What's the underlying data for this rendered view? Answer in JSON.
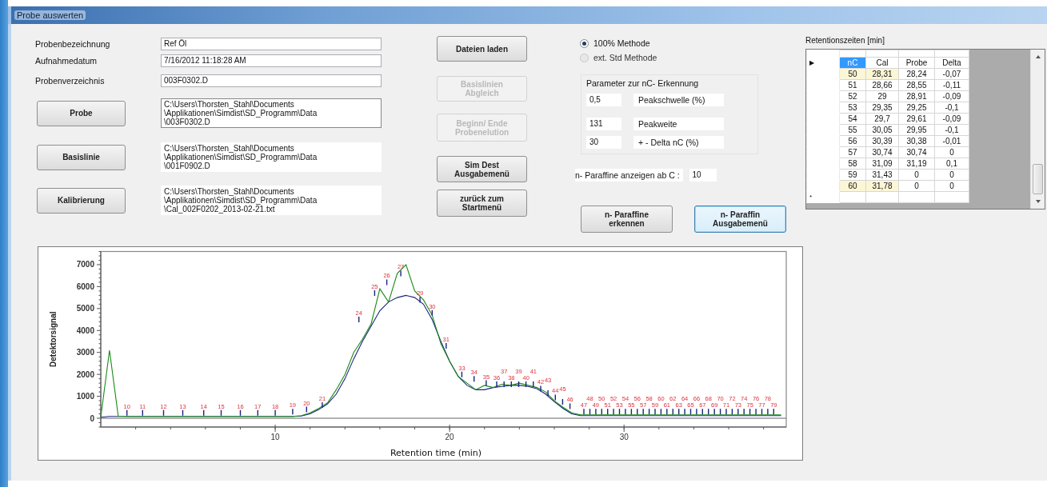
{
  "window": {
    "title": "Probe auswerten"
  },
  "sample": {
    "fields": [
      {
        "label": "Probenbezeichnung",
        "value": "Ref Öl"
      },
      {
        "label": "Aufnahmedatum",
        "value": "7/16/2012 11:18:28 AM"
      },
      {
        "label": "Probenverzeichnis",
        "value": "003F0302.D"
      }
    ],
    "file_rows": [
      {
        "button": "Probe",
        "path_lines": [
          "C:\\Users\\Thorsten_Stahl\\Documents",
          "\\Applikationen\\Simdist\\SD_Programm\\Data",
          "\\003F0302.D"
        ]
      },
      {
        "button": "Basislinie",
        "path_lines": [
          "C:\\Users\\Thorsten_Stahl\\Documents",
          "\\Applikationen\\Simdist\\SD_Programm\\Data",
          "\\001F0902.D"
        ]
      },
      {
        "button": "Kalibrierung",
        "path_lines": [
          "C:\\Users\\Thorsten_Stahl\\Documents",
          "\\Applikationen\\Simdist\\SD_Programm\\Data",
          "\\Cal_002F0202_2013-02-21.txt"
        ]
      }
    ]
  },
  "actions": [
    {
      "label": "Dateien laden",
      "disabled": false
    },
    {
      "label": "Basislinien Abgleich",
      "disabled": true
    },
    {
      "label": "Beginn/ Ende Probenelution",
      "disabled": true
    },
    {
      "label": "Sim Dest Ausgabemenü",
      "disabled": false
    },
    {
      "label": "zurück zum Startmenü",
      "disabled": false
    }
  ],
  "methods": [
    {
      "label": "100% Methode",
      "selected": true,
      "disabled": false
    },
    {
      "label": "ext. Std Methode",
      "selected": false,
      "disabled": true
    }
  ],
  "parameters": {
    "title": "Parameter zur nC- Erkennung",
    "rows": [
      {
        "value": "0,5",
        "label": "Peakschwelle (%)"
      },
      {
        "value": "131",
        "label": "Peakweite"
      },
      {
        "value": "30",
        "label": "+ - Delta nC (%)"
      }
    ]
  },
  "display_from": {
    "label": "n- Paraffine anzeigen ab C :",
    "value": "10"
  },
  "paraffin_buttons": [
    {
      "label": "n- Paraffine erkennen",
      "focused": false
    },
    {
      "label": "n- Paraffin Ausgabemenü",
      "focused": true
    }
  ],
  "table": {
    "title": "Retentionszeiten [min]",
    "current_row_marker": "▶",
    "new_row_marker": "*",
    "columns": [
      {
        "label": "nC",
        "selected": true
      },
      {
        "label": "Cal",
        "selected": false
      },
      {
        "label": "Probe",
        "selected": false
      },
      {
        "label": "Delta",
        "selected": false
      }
    ],
    "rows": [
      {
        "cells": [
          "50",
          "28,31",
          "28,24",
          "-0,07"
        ],
        "highlighted": true
      },
      {
        "cells": [
          "51",
          "28,66",
          "28,55",
          "-0,11"
        ],
        "highlighted": false
      },
      {
        "cells": [
          "52",
          "29",
          "28,91",
          "-0,09"
        ],
        "highlighted": false
      },
      {
        "cells": [
          "53",
          "29,35",
          "29,25",
          "-0,1"
        ],
        "highlighted": false
      },
      {
        "cells": [
          "54",
          "29,7",
          "29,61",
          "-0,09"
        ],
        "highlighted": false
      },
      {
        "cells": [
          "55",
          "30,05",
          "29,95",
          "-0,1"
        ],
        "highlighted": false
      },
      {
        "cells": [
          "56",
          "30,39",
          "30,38",
          "-0,01"
        ],
        "highlighted": false
      },
      {
        "cells": [
          "57",
          "30,74",
          "30,74",
          "0"
        ],
        "highlighted": false
      },
      {
        "cells": [
          "58",
          "31,09",
          "31,19",
          "0,1"
        ],
        "highlighted": false
      },
      {
        "cells": [
          "59",
          "31,43",
          "0",
          "0"
        ],
        "highlighted": false
      },
      {
        "cells": [
          "60",
          "31,78",
          "0",
          "0"
        ],
        "highlighted": true
      }
    ]
  },
  "chart": {
    "chart_data": {
      "type": "line",
      "xlabel": "Retention time (min)",
      "ylabel": "Detektorsignal",
      "x": [
        0,
        0.5,
        1,
        1.5,
        2,
        2.5,
        3,
        3.5,
        4,
        4.5,
        5,
        5.5,
        6,
        6.5,
        7,
        7.5,
        8,
        8.5,
        9,
        9.5,
        10,
        10.5,
        11,
        11.5,
        12,
        12.5,
        13,
        13.5,
        14,
        14.5,
        15,
        15.5,
        16,
        16.5,
        17,
        17.5,
        18,
        18.5,
        19,
        19.5,
        20,
        20.5,
        21,
        21.5,
        22,
        22.5,
        23,
        23.5,
        24,
        24.5,
        25,
        25.5,
        26,
        26.5,
        27,
        27.5,
        28,
        28.5,
        29,
        29.5,
        30,
        30.5,
        31,
        31.5,
        32,
        32.5,
        33,
        33.5,
        34,
        34.5,
        35,
        35.5,
        36,
        36.5,
        37,
        37.5,
        38,
        38.5,
        39
      ],
      "series": [
        {
          "color": "#1a8a1a",
          "values": [
            50,
            3100,
            100,
            80,
            80,
            80,
            80,
            80,
            80,
            80,
            80,
            80,
            80,
            80,
            80,
            80,
            80,
            80,
            80,
            80,
            80,
            80,
            80,
            120,
            250,
            450,
            700,
            1300,
            2000,
            3000,
            3600,
            4300,
            5900,
            5300,
            6600,
            7000,
            5800,
            5400,
            4700,
            3400,
            2600,
            1900,
            1600,
            1300,
            1500,
            1400,
            1550,
            1500,
            1600,
            1500,
            1400,
            1200,
            800,
            500,
            250,
            150,
            150,
            150,
            150,
            150,
            150,
            150,
            150,
            150,
            150,
            150,
            150,
            150,
            150,
            150,
            150,
            150,
            150,
            150,
            150,
            150,
            150,
            150,
            150
          ]
        },
        {
          "color": "#1a237e",
          "values": [
            50,
            80,
            80,
            80,
            80,
            80,
            80,
            80,
            80,
            80,
            80,
            80,
            80,
            80,
            80,
            80,
            80,
            80,
            80,
            80,
            80,
            80,
            80,
            100,
            200,
            400,
            650,
            1100,
            1800,
            2700,
            3500,
            4200,
            4900,
            5300,
            5500,
            5600,
            5500,
            5200,
            4500,
            3500,
            2600,
            1900,
            1500,
            1300,
            1300,
            1400,
            1450,
            1500,
            1500,
            1450,
            1350,
            1100,
            750,
            450,
            200,
            120,
            120,
            120,
            120,
            120,
            120,
            120,
            120,
            120,
            120,
            120,
            120,
            120,
            120,
            120,
            120,
            120,
            120,
            120,
            120,
            120,
            120,
            120,
            120
          ]
        }
      ],
      "xlim": [
        0,
        39.3
      ],
      "ylim": [
        -400,
        7600
      ],
      "xticks": [
        10,
        20,
        30
      ],
      "yticks": [
        0,
        1000,
        2000,
        3000,
        4000,
        5000,
        6000,
        7000
      ],
      "annotations": [
        "10",
        "11",
        "12",
        "13",
        "14",
        "15",
        "16",
        "17",
        "18",
        "19",
        "20",
        "21",
        "24",
        "25",
        "26",
        "27",
        "29",
        "30",
        "31",
        "33",
        "34",
        "35",
        "36",
        "37",
        "38",
        "39",
        "40",
        "41",
        "42",
        "43",
        "44",
        "45",
        "46",
        "47",
        "48",
        "49",
        "50",
        "51",
        "52",
        "53",
        "54",
        "55",
        "56",
        "57",
        "58",
        "59",
        "60",
        "61",
        "62",
        "63",
        "64",
        "65",
        "66",
        "67",
        "68",
        "69",
        "70",
        "71",
        "72",
        "73",
        "74",
        "75",
        "76",
        "77",
        "78",
        "79"
      ]
    }
  }
}
